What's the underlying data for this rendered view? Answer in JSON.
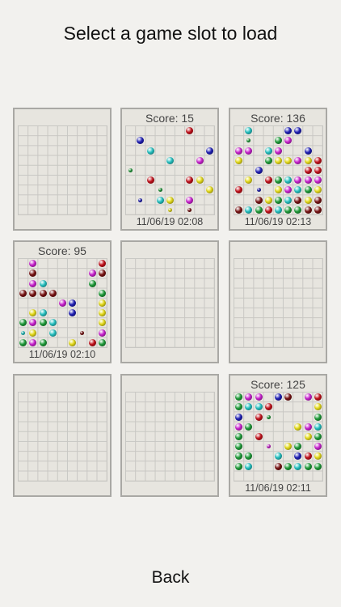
{
  "title": "Select a game slot to load",
  "back_label": "Back",
  "colors": {
    "red": "#c5111b",
    "blue": "#1f1fb8",
    "cyan": "#25c4c4",
    "green": "#1f9e3a",
    "yellow": "#e8de1a",
    "magenta": "#cc22d2",
    "maroon": "#7a1313"
  },
  "slots": [
    {
      "slot": 1,
      "score": "",
      "date": "",
      "balls": []
    },
    {
      "slot": 2,
      "score": "Score: 15",
      "date": "11/06/19 02:08",
      "balls": [
        {
          "r": 0,
          "c": 6,
          "color": "red",
          "size": "big"
        },
        {
          "r": 1,
          "c": 1,
          "color": "blue",
          "size": "big"
        },
        {
          "r": 2,
          "c": 2,
          "color": "cyan",
          "size": "big"
        },
        {
          "r": 2,
          "c": 8,
          "color": "blue",
          "size": "big"
        },
        {
          "r": 3,
          "c": 4,
          "color": "cyan",
          "size": "big"
        },
        {
          "r": 3,
          "c": 7,
          "color": "magenta",
          "size": "big"
        },
        {
          "r": 4,
          "c": 0,
          "color": "green",
          "size": "small"
        },
        {
          "r": 5,
          "c": 2,
          "color": "red",
          "size": "big"
        },
        {
          "r": 5,
          "c": 6,
          "color": "red",
          "size": "big"
        },
        {
          "r": 5,
          "c": 7,
          "color": "yellow",
          "size": "big"
        },
        {
          "r": 6,
          "c": 3,
          "color": "green",
          "size": "small"
        },
        {
          "r": 6,
          "c": 8,
          "color": "yellow",
          "size": "big"
        },
        {
          "r": 7,
          "c": 1,
          "color": "blue",
          "size": "small"
        },
        {
          "r": 7,
          "c": 3,
          "color": "cyan",
          "size": "big"
        },
        {
          "r": 7,
          "c": 4,
          "color": "yellow",
          "size": "big"
        },
        {
          "r": 7,
          "c": 6,
          "color": "magenta",
          "size": "big"
        },
        {
          "r": 8,
          "c": 4,
          "color": "yellow",
          "size": "small"
        },
        {
          "r": 8,
          "c": 6,
          "color": "maroon",
          "size": "small"
        }
      ]
    },
    {
      "slot": 3,
      "score": "Score: 136",
      "date": "11/06/19 02:13",
      "balls": [
        {
          "r": 0,
          "c": 1,
          "color": "cyan",
          "size": "big"
        },
        {
          "r": 0,
          "c": 5,
          "color": "blue",
          "size": "big"
        },
        {
          "r": 0,
          "c": 6,
          "color": "blue",
          "size": "big"
        },
        {
          "r": 1,
          "c": 1,
          "color": "green",
          "size": "small"
        },
        {
          "r": 1,
          "c": 4,
          "color": "green",
          "size": "big"
        },
        {
          "r": 1,
          "c": 5,
          "color": "magenta",
          "size": "big"
        },
        {
          "r": 2,
          "c": 0,
          "color": "magenta",
          "size": "big"
        },
        {
          "r": 2,
          "c": 1,
          "color": "magenta",
          "size": "big"
        },
        {
          "r": 2,
          "c": 3,
          "color": "cyan",
          "size": "big"
        },
        {
          "r": 2,
          "c": 4,
          "color": "magenta",
          "size": "big"
        },
        {
          "r": 2,
          "c": 7,
          "color": "blue",
          "size": "big"
        },
        {
          "r": 3,
          "c": 0,
          "color": "yellow",
          "size": "big"
        },
        {
          "r": 3,
          "c": 3,
          "color": "green",
          "size": "big"
        },
        {
          "r": 3,
          "c": 4,
          "color": "yellow",
          "size": "big"
        },
        {
          "r": 3,
          "c": 5,
          "color": "yellow",
          "size": "big"
        },
        {
          "r": 3,
          "c": 6,
          "color": "magenta",
          "size": "big"
        },
        {
          "r": 3,
          "c": 7,
          "color": "yellow",
          "size": "big"
        },
        {
          "r": 3,
          "c": 8,
          "color": "red",
          "size": "big"
        },
        {
          "r": 4,
          "c": 2,
          "color": "blue",
          "size": "big"
        },
        {
          "r": 4,
          "c": 7,
          "color": "red",
          "size": "big"
        },
        {
          "r": 4,
          "c": 8,
          "color": "red",
          "size": "big"
        },
        {
          "r": 5,
          "c": 1,
          "color": "yellow",
          "size": "big"
        },
        {
          "r": 5,
          "c": 3,
          "color": "red",
          "size": "big"
        },
        {
          "r": 5,
          "c": 4,
          "color": "green",
          "size": "big"
        },
        {
          "r": 5,
          "c": 5,
          "color": "cyan",
          "size": "big"
        },
        {
          "r": 5,
          "c": 6,
          "color": "magenta",
          "size": "big"
        },
        {
          "r": 5,
          "c": 7,
          "color": "magenta",
          "size": "big"
        },
        {
          "r": 5,
          "c": 8,
          "color": "magenta",
          "size": "big"
        },
        {
          "r": 6,
          "c": 0,
          "color": "red",
          "size": "big"
        },
        {
          "r": 6,
          "c": 2,
          "color": "blue",
          "size": "small"
        },
        {
          "r": 6,
          "c": 4,
          "color": "yellow",
          "size": "big"
        },
        {
          "r": 6,
          "c": 5,
          "color": "magenta",
          "size": "big"
        },
        {
          "r": 6,
          "c": 6,
          "color": "cyan",
          "size": "big"
        },
        {
          "r": 6,
          "c": 7,
          "color": "green",
          "size": "big"
        },
        {
          "r": 6,
          "c": 8,
          "color": "yellow",
          "size": "big"
        },
        {
          "r": 7,
          "c": 2,
          "color": "maroon",
          "size": "big"
        },
        {
          "r": 7,
          "c": 3,
          "color": "yellow",
          "size": "big"
        },
        {
          "r": 7,
          "c": 4,
          "color": "green",
          "size": "big"
        },
        {
          "r": 7,
          "c": 5,
          "color": "cyan",
          "size": "big"
        },
        {
          "r": 7,
          "c": 6,
          "color": "maroon",
          "size": "big"
        },
        {
          "r": 7,
          "c": 7,
          "color": "yellow",
          "size": "big"
        },
        {
          "r": 7,
          "c": 8,
          "color": "maroon",
          "size": "big"
        },
        {
          "r": 8,
          "c": 0,
          "color": "maroon",
          "size": "big"
        },
        {
          "r": 8,
          "c": 1,
          "color": "cyan",
          "size": "big"
        },
        {
          "r": 8,
          "c": 2,
          "color": "green",
          "size": "big"
        },
        {
          "r": 8,
          "c": 3,
          "color": "red",
          "size": "big"
        },
        {
          "r": 8,
          "c": 4,
          "color": "cyan",
          "size": "big"
        },
        {
          "r": 8,
          "c": 5,
          "color": "green",
          "size": "big"
        },
        {
          "r": 8,
          "c": 6,
          "color": "green",
          "size": "big"
        },
        {
          "r": 8,
          "c": 7,
          "color": "maroon",
          "size": "big"
        },
        {
          "r": 8,
          "c": 8,
          "color": "maroon",
          "size": "big"
        }
      ]
    },
    {
      "slot": 4,
      "score": "Score: 95",
      "date": "11/06/19 02:10",
      "balls": [
        {
          "r": 0,
          "c": 1,
          "color": "magenta",
          "size": "big"
        },
        {
          "r": 0,
          "c": 8,
          "color": "red",
          "size": "big"
        },
        {
          "r": 1,
          "c": 1,
          "color": "maroon",
          "size": "big"
        },
        {
          "r": 1,
          "c": 7,
          "color": "magenta",
          "size": "big"
        },
        {
          "r": 1,
          "c": 8,
          "color": "maroon",
          "size": "big"
        },
        {
          "r": 2,
          "c": 1,
          "color": "magenta",
          "size": "big"
        },
        {
          "r": 2,
          "c": 2,
          "color": "cyan",
          "size": "big"
        },
        {
          "r": 2,
          "c": 7,
          "color": "green",
          "size": "big"
        },
        {
          "r": 3,
          "c": 0,
          "color": "maroon",
          "size": "big"
        },
        {
          "r": 3,
          "c": 1,
          "color": "maroon",
          "size": "big"
        },
        {
          "r": 3,
          "c": 2,
          "color": "maroon",
          "size": "big"
        },
        {
          "r": 3,
          "c": 3,
          "color": "maroon",
          "size": "big"
        },
        {
          "r": 3,
          "c": 8,
          "color": "green",
          "size": "big"
        },
        {
          "r": 4,
          "c": 4,
          "color": "magenta",
          "size": "big"
        },
        {
          "r": 4,
          "c": 5,
          "color": "blue",
          "size": "big"
        },
        {
          "r": 4,
          "c": 8,
          "color": "yellow",
          "size": "big"
        },
        {
          "r": 5,
          "c": 1,
          "color": "yellow",
          "size": "big"
        },
        {
          "r": 5,
          "c": 2,
          "color": "cyan",
          "size": "big"
        },
        {
          "r": 5,
          "c": 5,
          "color": "blue",
          "size": "big"
        },
        {
          "r": 5,
          "c": 8,
          "color": "yellow",
          "size": "big"
        },
        {
          "r": 6,
          "c": 0,
          "color": "green",
          "size": "big"
        },
        {
          "r": 6,
          "c": 1,
          "color": "magenta",
          "size": "big"
        },
        {
          "r": 6,
          "c": 2,
          "color": "green",
          "size": "big"
        },
        {
          "r": 6,
          "c": 3,
          "color": "cyan",
          "size": "big"
        },
        {
          "r": 6,
          "c": 8,
          "color": "yellow",
          "size": "big"
        },
        {
          "r": 7,
          "c": 0,
          "color": "cyan",
          "size": "small"
        },
        {
          "r": 7,
          "c": 1,
          "color": "yellow",
          "size": "big"
        },
        {
          "r": 7,
          "c": 3,
          "color": "cyan",
          "size": "big"
        },
        {
          "r": 7,
          "c": 6,
          "color": "maroon",
          "size": "small"
        },
        {
          "r": 7,
          "c": 8,
          "color": "magenta",
          "size": "big"
        },
        {
          "r": 8,
          "c": 0,
          "color": "green",
          "size": "big"
        },
        {
          "r": 8,
          "c": 1,
          "color": "magenta",
          "size": "big"
        },
        {
          "r": 8,
          "c": 2,
          "color": "green",
          "size": "big"
        },
        {
          "r": 8,
          "c": 5,
          "color": "yellow",
          "size": "big"
        },
        {
          "r": 8,
          "c": 7,
          "color": "red",
          "size": "big"
        },
        {
          "r": 8,
          "c": 8,
          "color": "green",
          "size": "big"
        }
      ]
    },
    {
      "slot": 5,
      "score": "",
      "date": "",
      "balls": []
    },
    {
      "slot": 6,
      "score": "",
      "date": "",
      "balls": []
    },
    {
      "slot": 7,
      "score": "",
      "date": "",
      "balls": []
    },
    {
      "slot": 8,
      "score": "",
      "date": "",
      "balls": []
    },
    {
      "slot": 9,
      "score": "Score: 125",
      "date": "11/06/19 02:11",
      "balls": [
        {
          "r": 0,
          "c": 0,
          "color": "green",
          "size": "big"
        },
        {
          "r": 0,
          "c": 1,
          "color": "magenta",
          "size": "big"
        },
        {
          "r": 0,
          "c": 2,
          "color": "magenta",
          "size": "big"
        },
        {
          "r": 0,
          "c": 4,
          "color": "blue",
          "size": "big"
        },
        {
          "r": 0,
          "c": 5,
          "color": "maroon",
          "size": "big"
        },
        {
          "r": 0,
          "c": 7,
          "color": "magenta",
          "size": "big"
        },
        {
          "r": 0,
          "c": 8,
          "color": "red",
          "size": "big"
        },
        {
          "r": 1,
          "c": 0,
          "color": "green",
          "size": "big"
        },
        {
          "r": 1,
          "c": 1,
          "color": "cyan",
          "size": "big"
        },
        {
          "r": 1,
          "c": 2,
          "color": "cyan",
          "size": "big"
        },
        {
          "r": 1,
          "c": 3,
          "color": "red",
          "size": "big"
        },
        {
          "r": 1,
          "c": 8,
          "color": "yellow",
          "size": "big"
        },
        {
          "r": 2,
          "c": 0,
          "color": "blue",
          "size": "big"
        },
        {
          "r": 2,
          "c": 2,
          "color": "red",
          "size": "big"
        },
        {
          "r": 2,
          "c": 3,
          "color": "green",
          "size": "small"
        },
        {
          "r": 2,
          "c": 8,
          "color": "green",
          "size": "big"
        },
        {
          "r": 3,
          "c": 0,
          "color": "magenta",
          "size": "big"
        },
        {
          "r": 3,
          "c": 1,
          "color": "green",
          "size": "big"
        },
        {
          "r": 3,
          "c": 6,
          "color": "yellow",
          "size": "big"
        },
        {
          "r": 3,
          "c": 7,
          "color": "magenta",
          "size": "big"
        },
        {
          "r": 3,
          "c": 8,
          "color": "cyan",
          "size": "big"
        },
        {
          "r": 4,
          "c": 0,
          "color": "green",
          "size": "big"
        },
        {
          "r": 4,
          "c": 2,
          "color": "red",
          "size": "big"
        },
        {
          "r": 4,
          "c": 7,
          "color": "yellow",
          "size": "big"
        },
        {
          "r": 4,
          "c": 8,
          "color": "green",
          "size": "big"
        },
        {
          "r": 5,
          "c": 0,
          "color": "green",
          "size": "big"
        },
        {
          "r": 5,
          "c": 3,
          "color": "magenta",
          "size": "small"
        },
        {
          "r": 5,
          "c": 5,
          "color": "yellow",
          "size": "big"
        },
        {
          "r": 5,
          "c": 6,
          "color": "green",
          "size": "big"
        },
        {
          "r": 5,
          "c": 8,
          "color": "magenta",
          "size": "big"
        },
        {
          "r": 6,
          "c": 0,
          "color": "green",
          "size": "big"
        },
        {
          "r": 6,
          "c": 1,
          "color": "green",
          "size": "big"
        },
        {
          "r": 6,
          "c": 4,
          "color": "cyan",
          "size": "big"
        },
        {
          "r": 6,
          "c": 6,
          "color": "blue",
          "size": "big"
        },
        {
          "r": 6,
          "c": 7,
          "color": "red",
          "size": "big"
        },
        {
          "r": 6,
          "c": 8,
          "color": "yellow",
          "size": "big"
        },
        {
          "r": 7,
          "c": 0,
          "color": "green",
          "size": "big"
        },
        {
          "r": 7,
          "c": 1,
          "color": "cyan",
          "size": "big"
        },
        {
          "r": 7,
          "c": 4,
          "color": "maroon",
          "size": "big"
        },
        {
          "r": 7,
          "c": 5,
          "color": "green",
          "size": "big"
        },
        {
          "r": 7,
          "c": 6,
          "color": "cyan",
          "size": "big"
        },
        {
          "r": 7,
          "c": 7,
          "color": "green",
          "size": "big"
        },
        {
          "r": 7,
          "c": 8,
          "color": "green",
          "size": "big"
        }
      ]
    }
  ]
}
